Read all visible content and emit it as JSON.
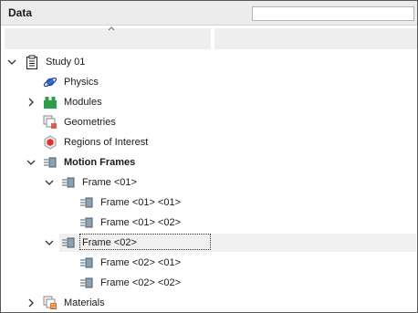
{
  "panel": {
    "title": "Data",
    "search": {
      "value": "",
      "placeholder": ""
    }
  },
  "tree": {
    "items": [
      {
        "label": "Study 01",
        "icon": "clipboard-icon",
        "expanded": true
      },
      {
        "label": "Physics",
        "icon": "planet-icon"
      },
      {
        "label": "Modules",
        "icon": "modules-icon",
        "expanded": false
      },
      {
        "label": "Geometries",
        "icon": "geometries-icon"
      },
      {
        "label": "Regions of Interest",
        "icon": "regions-icon"
      },
      {
        "label": "Motion Frames",
        "icon": "motion-frames-icon",
        "expanded": true,
        "bold": true
      },
      {
        "label": "Frame <01>",
        "icon": "frame-icon",
        "expanded": true
      },
      {
        "label": "Frame <01> <01>",
        "icon": "frame-icon"
      },
      {
        "label": "Frame <01> <02>",
        "icon": "frame-icon"
      },
      {
        "label": "Frame <02>",
        "icon": "frame-icon",
        "expanded": true,
        "selected": true
      },
      {
        "label": "Frame <02> <01>",
        "icon": "frame-icon"
      },
      {
        "label": "Frame <02> <02>",
        "icon": "frame-icon"
      },
      {
        "label": "Materials",
        "icon": "materials-icon",
        "expanded": false
      }
    ]
  },
  "colors": {
    "selection": "#f0f0f0",
    "header": "#ececec",
    "planet": "#3a6fd8",
    "modules": "#2e9e4a",
    "regions": "#e03030",
    "frame": "#6a7a8a",
    "materials": "#e07020"
  }
}
